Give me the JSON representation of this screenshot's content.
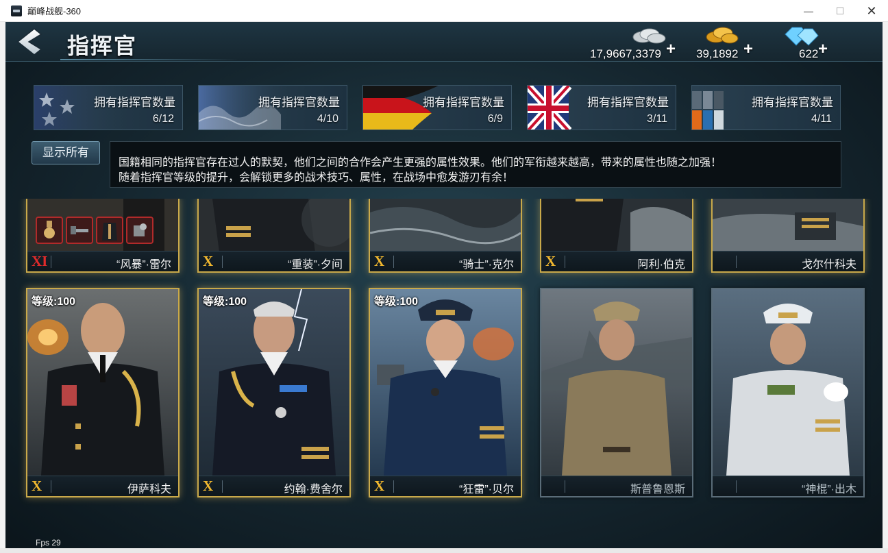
{
  "window": {
    "title": "巅峰战舰-360",
    "minimize": "—",
    "maximize": "☐",
    "close": "✕"
  },
  "header": {
    "title": "指挥官"
  },
  "resources": [
    {
      "name": "silver",
      "value": "17,9667,3379",
      "plus": "+"
    },
    {
      "name": "gold",
      "value": "39,1892",
      "plus": "+"
    },
    {
      "name": "diamond",
      "value": "622",
      "plus": "+"
    }
  ],
  "nations": [
    {
      "flag": "usa-flag-icon",
      "label": "拥有指挥官数量",
      "count": "6/12"
    },
    {
      "flag": "japan-flag-icon",
      "label": "拥有指挥官数量",
      "count": "4/10"
    },
    {
      "flag": "germany-flag-icon",
      "label": "拥有指挥官数量",
      "count": "6/9"
    },
    {
      "flag": "uk-flag-icon",
      "label": "拥有指挥官数量",
      "count": "3/11"
    },
    {
      "flag": "soviet-flag-icon",
      "label": "拥有指挥官数量",
      "count": "4/11"
    }
  ],
  "show_all_button": "显示所有",
  "info": {
    "line1": "国籍相同的指挥官存在过人的默契，他们之间的合作会产生更强的属性效果。他们的军衔越来越高，带来的属性也随之加强！",
    "line2": "随着指挥官等级的提升，会解锁更多的战术技巧、属性，在战场中愈发游刃有余！"
  },
  "cards_row1": [
    {
      "rank": "XI",
      "name": "“风暴”·雷尔"
    },
    {
      "rank": "X",
      "name": "“重装”·夕间"
    },
    {
      "rank": "X",
      "name": "“骑士”·克尔"
    },
    {
      "rank": "X",
      "name": "阿利·伯克"
    },
    {
      "rank": "",
      "name": "戈尔什科夫"
    }
  ],
  "cards_row2": [
    {
      "level": "等级:100",
      "rank": "X",
      "name": "伊萨科夫"
    },
    {
      "level": "等级:100",
      "rank": "X",
      "name": "约翰·费舍尔"
    },
    {
      "level": "等级:100",
      "rank": "X",
      "name": "“狂雷”·贝尔"
    },
    {
      "level": "",
      "rank": "",
      "name": "斯普鲁恩斯"
    },
    {
      "level": "",
      "rank": "",
      "name": "“神棍”·出木"
    }
  ],
  "colors": {
    "gold_border": "#c9a94a",
    "rank_gold": "#f0b72f",
    "rank_red": "#e02b2b",
    "panel_bg": "#1d3140"
  },
  "fps": "Fps 29"
}
